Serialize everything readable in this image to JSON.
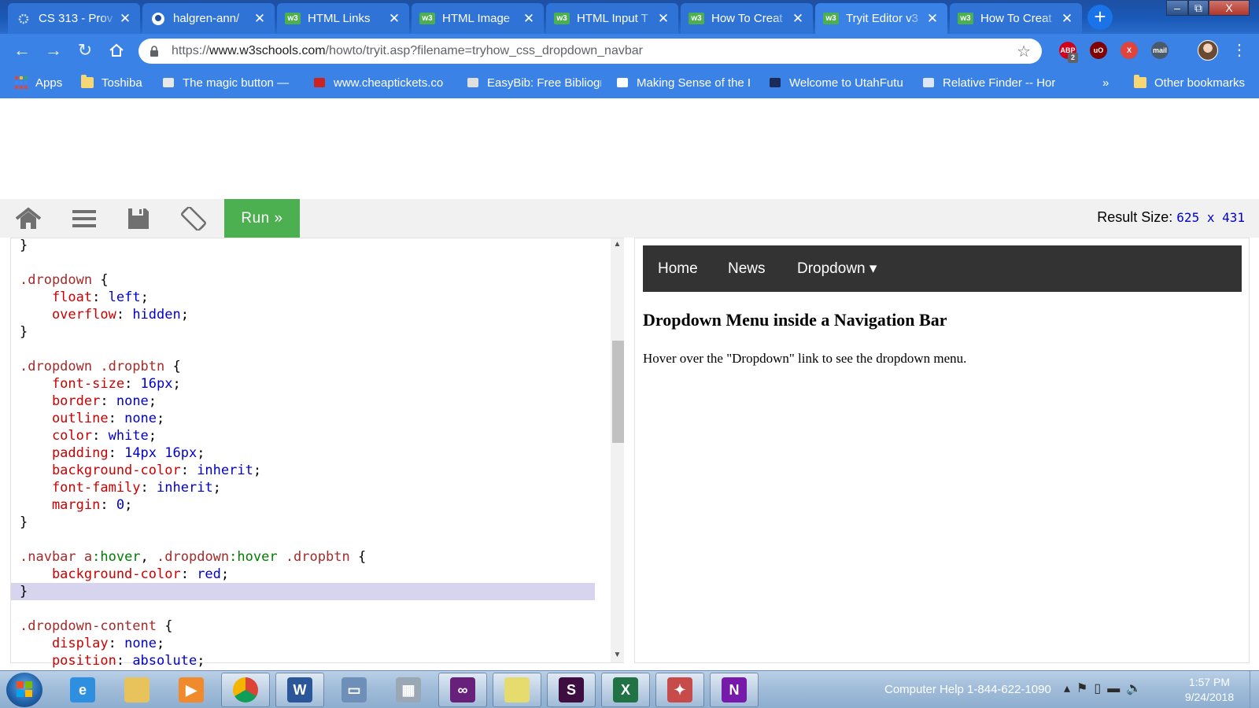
{
  "browser": {
    "tabs": [
      {
        "title": "CS 313 - Prov",
        "favicon": "gear-favicon"
      },
      {
        "title": "halgren-ann/",
        "favicon": "github-favicon"
      },
      {
        "title": "HTML Links",
        "favicon": "w3schools-favicon"
      },
      {
        "title": "HTML Image",
        "favicon": "w3schools-favicon"
      },
      {
        "title": "HTML Input T",
        "favicon": "w3schools-favicon"
      },
      {
        "title": "How To Creat",
        "favicon": "w3schools-favicon"
      },
      {
        "title": "Tryit Editor v3",
        "favicon": "w3schools-favicon",
        "active": true
      },
      {
        "title": "How To Creat",
        "favicon": "w3schools-favicon"
      }
    ],
    "window_controls": {
      "minimize": "–",
      "maximize": "⧉",
      "close": "X"
    },
    "url": {
      "scheme": "https://",
      "host": "www.w3schools.com",
      "path": "/howto/tryit.asp?filename=tryhow_css_dropdown_navbar"
    },
    "extensions": [
      {
        "name": "ABP",
        "badge": "2",
        "color": "#d0021b"
      },
      {
        "name": "uO",
        "color": "#800000"
      },
      {
        "name": "X",
        "color": "#e0443c"
      },
      {
        "name": "mail",
        "color": "#4a5a6a"
      }
    ],
    "bookmarks": {
      "apps": "Apps",
      "items": [
        "Toshiba",
        "The magic button —",
        "www.cheaptickets.co",
        "EasyBib: Free Bibliogr",
        "Making Sense of the I",
        "Welcome to UtahFutu",
        "Relative Finder -- Hor"
      ],
      "overflow": "»",
      "other": "Other bookmarks"
    }
  },
  "tryit": {
    "run_label": "Run »",
    "result_size_label": "Result Size:",
    "result_size_value": "625 x 431",
    "code_lines": [
      [
        {
          "t": "}",
          "c": "punc"
        }
      ],
      [],
      [
        {
          "t": ".dropdown",
          "c": "sel"
        },
        {
          "t": " {",
          "c": "punc"
        }
      ],
      [
        {
          "t": "    float",
          "c": "prop"
        },
        {
          "t": ": ",
          "c": "punc"
        },
        {
          "t": "left",
          "c": "val"
        },
        {
          "t": ";",
          "c": "punc"
        }
      ],
      [
        {
          "t": "    overflow",
          "c": "prop"
        },
        {
          "t": ": ",
          "c": "punc"
        },
        {
          "t": "hidden",
          "c": "val"
        },
        {
          "t": ";",
          "c": "punc"
        }
      ],
      [
        {
          "t": "}",
          "c": "punc"
        }
      ],
      [],
      [
        {
          "t": ".dropdown .dropbtn",
          "c": "sel"
        },
        {
          "t": " {",
          "c": "punc"
        }
      ],
      [
        {
          "t": "    font-size",
          "c": "prop"
        },
        {
          "t": ": ",
          "c": "punc"
        },
        {
          "t": "16px",
          "c": "val"
        },
        {
          "t": ";",
          "c": "punc"
        }
      ],
      [
        {
          "t": "    border",
          "c": "prop"
        },
        {
          "t": ": ",
          "c": "punc"
        },
        {
          "t": "none",
          "c": "val"
        },
        {
          "t": ";",
          "c": "punc"
        }
      ],
      [
        {
          "t": "    outline",
          "c": "prop"
        },
        {
          "t": ": ",
          "c": "punc"
        },
        {
          "t": "none",
          "c": "val"
        },
        {
          "t": ";",
          "c": "punc"
        }
      ],
      [
        {
          "t": "    color",
          "c": "prop"
        },
        {
          "t": ": ",
          "c": "punc"
        },
        {
          "t": "white",
          "c": "val"
        },
        {
          "t": ";",
          "c": "punc"
        }
      ],
      [
        {
          "t": "    padding",
          "c": "prop"
        },
        {
          "t": ": ",
          "c": "punc"
        },
        {
          "t": "14px 16px",
          "c": "val"
        },
        {
          "t": ";",
          "c": "punc"
        }
      ],
      [
        {
          "t": "    background-color",
          "c": "prop"
        },
        {
          "t": ": ",
          "c": "punc"
        },
        {
          "t": "inherit",
          "c": "val"
        },
        {
          "t": ";",
          "c": "punc"
        }
      ],
      [
        {
          "t": "    font-family",
          "c": "prop"
        },
        {
          "t": ": ",
          "c": "punc"
        },
        {
          "t": "inherit",
          "c": "val"
        },
        {
          "t": ";",
          "c": "punc"
        }
      ],
      [
        {
          "t": "    margin",
          "c": "prop"
        },
        {
          "t": ": ",
          "c": "punc"
        },
        {
          "t": "0",
          "c": "val"
        },
        {
          "t": ";",
          "c": "punc"
        }
      ],
      [
        {
          "t": "}",
          "c": "punc"
        }
      ],
      [],
      [
        {
          "t": ".navbar a",
          "c": "sel"
        },
        {
          "t": ":hover",
          "c": "pseudo"
        },
        {
          "t": ", ",
          "c": "punc"
        },
        {
          "t": ".dropdown",
          "c": "sel"
        },
        {
          "t": ":hover",
          "c": "pseudo"
        },
        {
          "t": " .dropbtn",
          "c": "sel"
        },
        {
          "t": " {",
          "c": "punc"
        }
      ],
      [
        {
          "t": "    background-color",
          "c": "prop"
        },
        {
          "t": ": ",
          "c": "punc"
        },
        {
          "t": "red",
          "c": "val"
        },
        {
          "t": ";",
          "c": "punc"
        }
      ],
      [
        {
          "t": "}",
          "c": "punc",
          "hl": true
        }
      ],
      [],
      [
        {
          "t": ".dropdown-content",
          "c": "sel"
        },
        {
          "t": " {",
          "c": "punc"
        }
      ],
      [
        {
          "t": "    display",
          "c": "prop"
        },
        {
          "t": ": ",
          "c": "punc"
        },
        {
          "t": "none",
          "c": "val"
        },
        {
          "t": ";",
          "c": "punc"
        }
      ],
      [
        {
          "t": "    position",
          "c": "prop"
        },
        {
          "t": ": ",
          "c": "punc"
        },
        {
          "t": "absolute",
          "c": "val"
        },
        {
          "t": ";",
          "c": "punc"
        }
      ]
    ],
    "result": {
      "nav_links": [
        "Home",
        "News",
        "Dropdown"
      ],
      "dropdown_caret": "▾",
      "heading": "Dropdown Menu inside a Navigation Bar",
      "paragraph": "Hover over the \"Dropdown\" link to see the dropdown menu."
    }
  },
  "taskbar": {
    "apps": [
      {
        "name": "internet-explorer",
        "open": false,
        "color": "#2e8fe0",
        "glyph": "e"
      },
      {
        "name": "file-explorer",
        "open": false,
        "color": "#e8c25a",
        "glyph": ""
      },
      {
        "name": "media-player",
        "open": false,
        "color": "#f08a2a",
        "glyph": "▶"
      },
      {
        "name": "chrome",
        "open": true,
        "color": "#db4437",
        "glyph": ""
      },
      {
        "name": "word",
        "open": true,
        "color": "#2b579a",
        "glyph": "W"
      },
      {
        "name": "remote-desktop",
        "open": false,
        "color": "#6d8fb8",
        "glyph": "▭"
      },
      {
        "name": "calculator",
        "open": false,
        "color": "#9aa7b5",
        "glyph": "▦"
      },
      {
        "name": "visual-studio",
        "open": true,
        "color": "#68217a",
        "glyph": "∞"
      },
      {
        "name": "sticky-notes",
        "open": true,
        "color": "#e6dc6e",
        "glyph": ""
      },
      {
        "name": "slack",
        "open": true,
        "color": "#3f0e40",
        "glyph": "S"
      },
      {
        "name": "excel",
        "open": true,
        "color": "#217346",
        "glyph": "X"
      },
      {
        "name": "snipping-tool",
        "open": true,
        "color": "#c84b4b",
        "glyph": "✦"
      },
      {
        "name": "onenote",
        "open": true,
        "color": "#7719aa",
        "glyph": "N"
      }
    ],
    "computer_help": "Computer Help 1-844-622-1090",
    "clock_time": "1:57 PM",
    "clock_date": "9/24/2018"
  }
}
